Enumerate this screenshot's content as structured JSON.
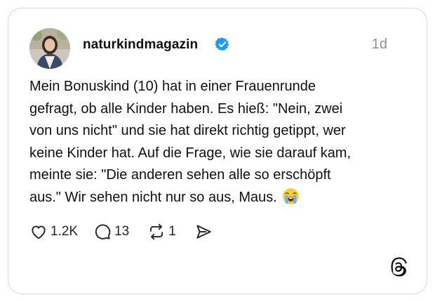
{
  "post": {
    "username": "naturkindmagazin",
    "verified": true,
    "time": "1d",
    "text": "Mein Bonuskind (10) hat in einer Frauenrunde\ngefragt, ob alle Kinder haben. Es hieß: \"Nein, zwei\nvon uns nicht\" und sie hat direkt richtig getippt, wer\nkeine Kinder hat. Auf die Frage, wie sie darauf kam,\nmeinte sie: \"Die anderen sehen alle so erschöpft\naus.\" Wir sehen nicht nur so aus, Maus. ",
    "emoji": "loudly-crying-face"
  },
  "actions": {
    "likes": "1.2K",
    "replies": "13",
    "reposts": "1"
  },
  "icons": {
    "like": "heart-icon",
    "reply": "speech-bubble-icon",
    "repost": "repost-icon",
    "share": "send-icon",
    "brand": "threads-logo-icon"
  },
  "colors": {
    "verified_badge": "#1d9bf0",
    "text": "#101010",
    "muted": "#8f8f8f",
    "border": "#d9d9d9"
  }
}
